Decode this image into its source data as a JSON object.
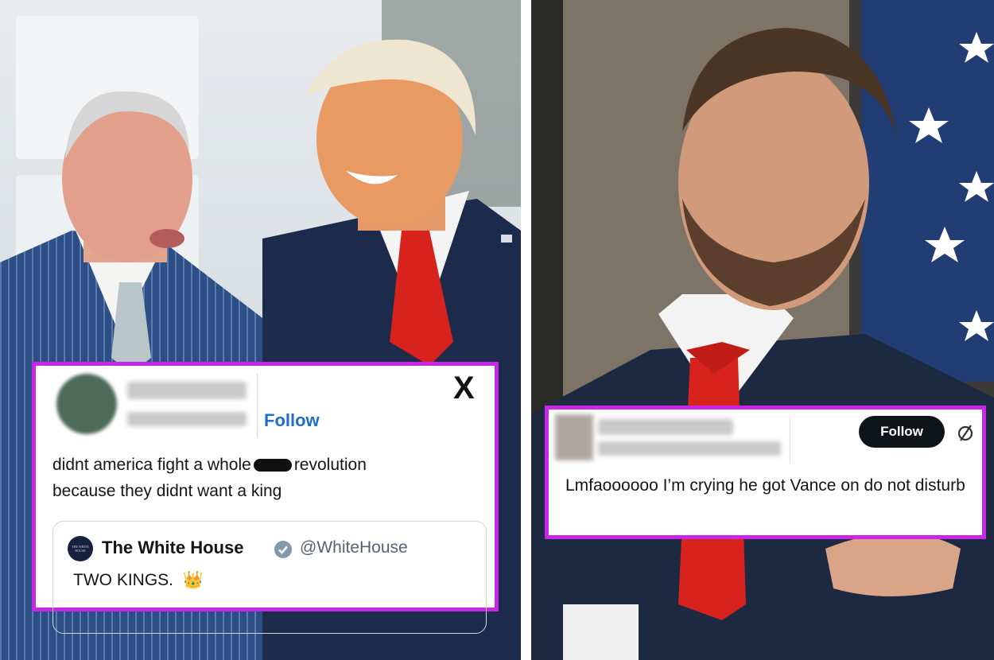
{
  "left_tweet": {
    "follow_label": "Follow",
    "x_logo": "X",
    "text_part1": "didnt america fight a whole",
    "text_part2": "revolution",
    "text_line2": "because they didnt want a king",
    "quote": {
      "avatar_text": "THE WHITE HOUSE",
      "name": "The White House",
      "verified_icon": "verified-check-icon",
      "handle": "@WhiteHouse",
      "text": "TWO KINGS.",
      "emoji": "👑"
    }
  },
  "right_tweet": {
    "follow_label": "Follow",
    "icon": "circle-slash-icon",
    "text": "Lmfaoooooo I’m crying he got Vance on do not disturb"
  },
  "colors": {
    "card_border": "#c828e6",
    "follow_link": "#1d6fc9",
    "tie_red": "#d8221d",
    "suit_navy": "#1c2b4b"
  }
}
